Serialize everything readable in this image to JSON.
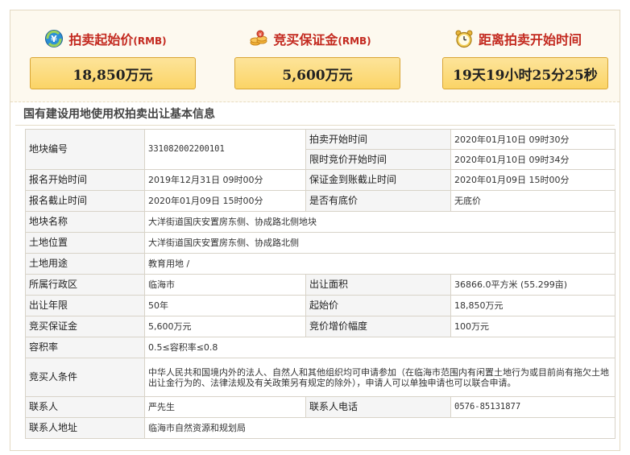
{
  "summary": {
    "start_price": {
      "label": "拍卖起始价",
      "unit": "(RMB)",
      "value": "18,850万元",
      "icon": "money-circle-icon"
    },
    "deposit": {
      "label": "竞买保证金",
      "unit": "(RMB)",
      "value": "5,600万元",
      "icon": "coins-icon"
    },
    "countdown": {
      "label": "距离拍卖开始时间",
      "value": "19天19小时25分25秒",
      "icon": "alarm-clock-icon"
    }
  },
  "section_title": "国有建设用地使用权拍卖出让基本信息",
  "info": {
    "plot_no_label": "地块编号",
    "plot_no": "331082002200101",
    "auction_start_label": "拍卖开始时间",
    "auction_start": "2020年01月10日 09时30分",
    "timed_start_label": "限时竞价开始时间",
    "timed_start": "2020年01月10日 09时34分",
    "reg_start_label": "报名开始时间",
    "reg_start": "2019年12月31日 09时00分",
    "deposit_deadline_label": "保证金到账截止时间",
    "deposit_deadline": "2020年01月09日 15时00分",
    "reg_end_label": "报名截止时间",
    "reg_end": "2020年01月09日 15时00分",
    "reserve_label": "是否有底价",
    "reserve": "无底价",
    "plot_name_label": "地块名称",
    "plot_name": "大洋街道国庆安置房东侧、协成路北侧地块",
    "location_label": "土地位置",
    "location": "大洋街道国庆安置房东侧、协成路北侧",
    "usage_label": "土地用途",
    "usage": "教育用地 /",
    "district_label": "所属行政区",
    "district": "临海市",
    "area_label": "出让面积",
    "area": "36866.0平方米 (55.299亩)",
    "term_label": "出让年限",
    "term": "50年",
    "start_price_label": "起始价",
    "start_price": "18,850万元",
    "deposit_label": "竞买保证金",
    "deposit": "5,600万元",
    "increment_label": "竞价增价幅度",
    "increment": "100万元",
    "far_label": "容积率",
    "far": "0.5≤容积率≤0.8",
    "conditions_label": "竞买人条件",
    "conditions": "中华人民共和国境内外的法人、自然人和其他组织均可申请参加（在临海市范围内有闲置土地行为或目前尚有拖欠土地出让金行为的、法律法规及有关政策另有规定的除外），申请人可以单独申请也可以联合申请。",
    "contact_label": "联系人",
    "contact": "严先生",
    "phone_label": "联系人电话",
    "phone": "0576-85131877",
    "address_label": "联系人地址",
    "address": "临海市自然资源和规划局"
  }
}
